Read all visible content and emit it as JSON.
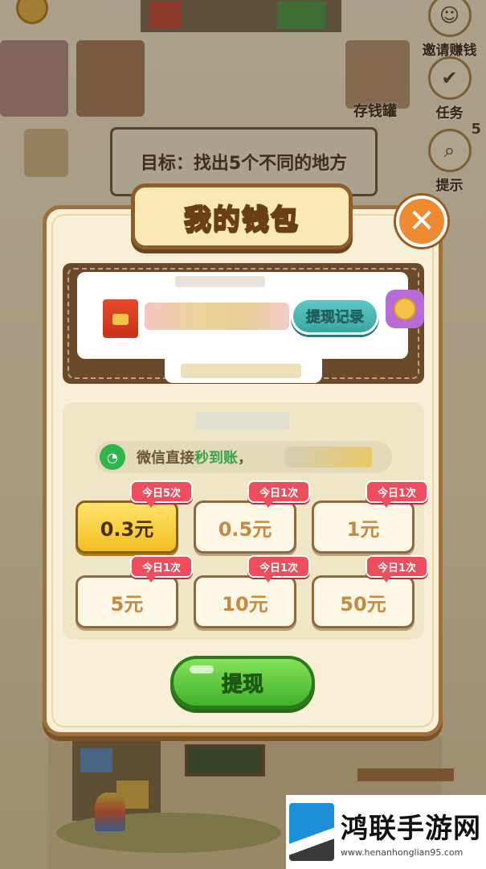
{
  "scene": {
    "side_buttons": [
      {
        "label": "邀请赚钱",
        "icon": "invite-icon"
      },
      {
        "label": "任务",
        "icon": "task-check-icon"
      },
      {
        "label": "提示",
        "icon": "magnifier-icon"
      }
    ],
    "hint_count": "5",
    "save_money_label": "存钱罐",
    "goal_text": "目标：找出5个不同的地方"
  },
  "wallet": {
    "title": "我的钱包",
    "close_icon": "close-icon",
    "withdraw_record_label": "提现记录",
    "wechat_notice": {
      "prefix": "微信直接",
      "highlight": "秒到账",
      "suffix": "，"
    },
    "amounts": [
      {
        "label": "0.3元",
        "limit": "今日5次",
        "selected": true
      },
      {
        "label": "0.5元",
        "limit": "今日1次",
        "selected": false
      },
      {
        "label": "1元",
        "limit": "今日1次",
        "selected": false
      },
      {
        "label": "5元",
        "limit": "今日1次",
        "selected": false
      },
      {
        "label": "10元",
        "limit": "今日1次",
        "selected": false
      },
      {
        "label": "50元",
        "limit": "今日1次",
        "selected": false
      }
    ],
    "withdraw_label": "提现"
  },
  "watermark": {
    "title": "鸿联手游网",
    "url": "www.henanhonglian95.com"
  },
  "colors": {
    "dialog_bg": "#f7efd6",
    "dialog_border": "#a0703a",
    "selected_amount": "#f3be22",
    "limit_tag": "#ee4d5e",
    "withdraw_button": "#3fb32a",
    "record_button": "#3aa6a4",
    "wechat_green": "#2fb54a"
  }
}
